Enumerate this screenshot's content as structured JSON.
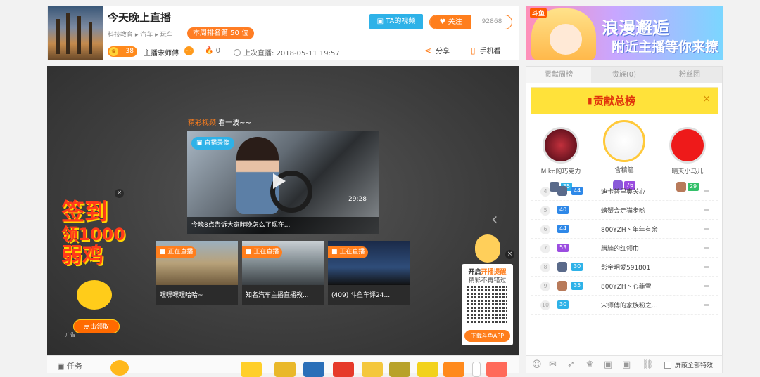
{
  "header": {
    "title": "今天晚上直播",
    "breadcrumb": [
      "科技教育",
      "汽车",
      "玩车"
    ],
    "rank_badge": "本周排名第 50 位",
    "level": "38",
    "anchor": "主播宋师傅",
    "hot_count": "0",
    "last_live_label": "上次直播:",
    "last_live_time": "2018-05-11 19:57",
    "ta_video_label": "TA的视频",
    "follow_label": "关注",
    "follow_count": "92868",
    "share_label": "分享",
    "phone_label": "手机看"
  },
  "ad_banner": {
    "logo": "斗鱼",
    "line1": "浪漫邂逅",
    "line2": "附近主播等你来撩"
  },
  "player": {
    "highlight_tag": "精彩视频",
    "highlight_text": "看一波~~",
    "main_video": {
      "tag": "直播录像",
      "duration": "29:28",
      "caption": "今晚8点告诉大家昨晚怎么了现在..."
    },
    "recommended": [
      {
        "tag": "正在直播",
        "caption": "嘿嘿嘿嘿哈哈~"
      },
      {
        "tag": "正在直播",
        "caption": "知名汽车主播直播教..."
      },
      {
        "tag": "正在直播",
        "caption": "(409) 斗鱼车评24..."
      }
    ],
    "signin": {
      "line1": "签到",
      "line2": "领1000",
      "line3": "弱鸡",
      "button": "点击领取",
      "ad_label": "广告"
    },
    "qr_popup": {
      "title_prefix": "开启",
      "title_highlight": "开播提醒",
      "subtitle": "精彩不再错过",
      "download": "下载斗鱼APP"
    }
  },
  "bottom_bar": {
    "task_label": "任务"
  },
  "sidebar": {
    "tabs": [
      "贡献周榜",
      "贵族(0)",
      "粉丝团"
    ],
    "panel_title": "贡献总榜",
    "top3": [
      {
        "rank": 2,
        "name": "Miko的巧克力",
        "level": "35"
      },
      {
        "rank": 1,
        "name": "含精籠",
        "level": "76"
      },
      {
        "rank": 3,
        "name": "晴天小马儿",
        "level": "29"
      }
    ],
    "list": [
      {
        "rank": "4",
        "level": "44",
        "name": "迪卡普里奥关心"
      },
      {
        "rank": "5",
        "level": "40",
        "name": "螃蟹会走猫步哟"
      },
      {
        "rank": "6",
        "level": "44",
        "name": "800YZH丶年年有余"
      },
      {
        "rank": "7",
        "level": "53",
        "name": "腊腩的红领巾"
      },
      {
        "rank": "8",
        "level": "30",
        "name": "影金玥爱591801"
      },
      {
        "rank": "9",
        "level": "35",
        "name": "800YZH丶心菲雪"
      },
      {
        "rank": "10",
        "level": "30",
        "name": "宋师傅的家族粉之..."
      }
    ],
    "shield_label": "屏蔽全部特效"
  },
  "colors": {
    "accent_orange": "#ff7e1c",
    "accent_blue": "#2eb2e8",
    "panel_yellow": "#ffe23a"
  }
}
